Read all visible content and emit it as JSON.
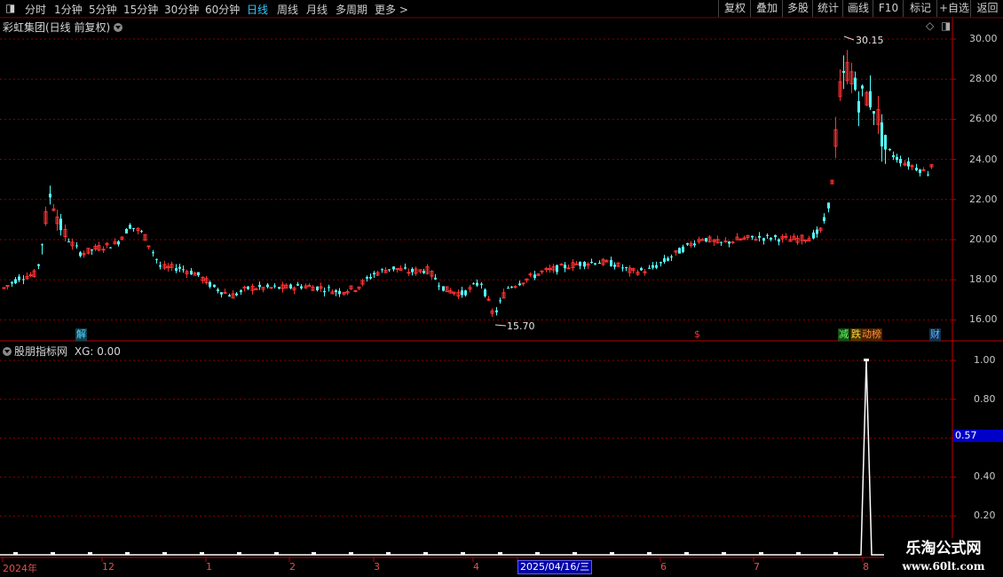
{
  "toolbar": {
    "left_items": [
      "分时",
      "1分钟",
      "5分钟",
      "15分钟",
      "30分钟",
      "60分钟",
      "日线",
      "周线",
      "月线",
      "多周期",
      "更多 >"
    ],
    "active_item": "日线",
    "right_items": [
      "复权",
      "叠加",
      "多股",
      "统计",
      "画线",
      "F10",
      "+自选",
      "返回"
    ],
    "right_extra": "标记"
  },
  "main_panel": {
    "title": "彩虹集团(日线 前复权)",
    "high_label": "30.15",
    "low_label": "15.70",
    "y_ticks": [
      "30.00",
      "28.00",
      "26.00",
      "24.00",
      "22.00",
      "20.00",
      "18.00",
      "16.00"
    ],
    "event_tags": [
      {
        "text": "解",
        "color": "#38b6d8"
      },
      {
        "text": "$",
        "color": "#e02020"
      },
      {
        "text": "减",
        "color": "#30c030"
      },
      {
        "text": "跌",
        "color": "#e0c030"
      },
      {
        "text": "动榜",
        "color": "#e07020"
      },
      {
        "text": "财",
        "color": "#3aa0e0"
      }
    ]
  },
  "indicator_panel": {
    "title": "股朋指标网",
    "value_label": "XG: 0.00",
    "y_ticks": [
      "1.00",
      "0.80",
      "0.57",
      "0.40",
      "0.20"
    ],
    "highlight_value": "0.57"
  },
  "time_axis": {
    "labels": [
      "2024年",
      "12",
      "1",
      "2",
      "3",
      "4",
      "2025/04/16/三",
      "6",
      "7",
      "8"
    ]
  },
  "watermark": {
    "line1": "乐淘公式网",
    "line2": "www.60lt.com"
  },
  "colors": {
    "up": "#ff3232",
    "down": "#54ffff",
    "grid": "#8c0000",
    "axis": "#c00000",
    "active_tab": "#35c8ff"
  }
}
